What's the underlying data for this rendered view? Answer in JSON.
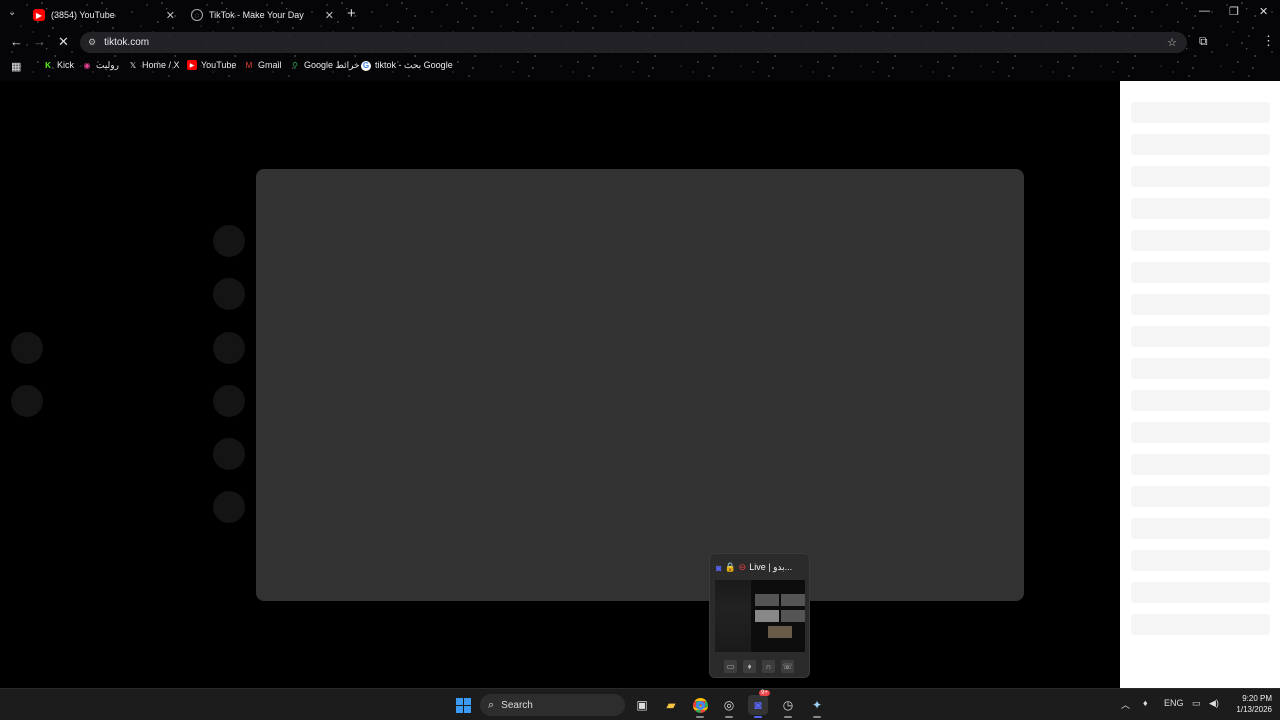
{
  "browser": {
    "tabs": [
      {
        "title": "(3854) YouTube",
        "icon": "youtube-icon"
      },
      {
        "title": "TikTok - Make Your Day",
        "icon": "tiktok-icon"
      }
    ],
    "address": "tiktok.com",
    "bookmarks": [
      {
        "label": "Kick",
        "icon": "kick-icon",
        "color": "#53fc18"
      },
      {
        "label": "رولیت",
        "icon": "roulette-icon",
        "color": "#e84393"
      },
      {
        "label": "Home / X",
        "icon": "x-icon",
        "color": "#ffffff"
      },
      {
        "label": "YouTube",
        "icon": "youtube-icon",
        "color": "#ff0000"
      },
      {
        "label": "Gmail",
        "icon": "gmail-icon",
        "color": "#ea4335"
      },
      {
        "label": "Google خرائط",
        "icon": "maps-icon",
        "color": "#34a853"
      },
      {
        "label": "tiktok - بحث Google",
        "icon": "google-icon",
        "color": "#ffffff"
      }
    ]
  },
  "popup": {
    "title": "Live | بدو..."
  },
  "taskbar": {
    "search_label": "Search",
    "lang": "ENG",
    "time": "9:20 PM",
    "date": "1/13/2026",
    "notification_badge": "9+"
  }
}
